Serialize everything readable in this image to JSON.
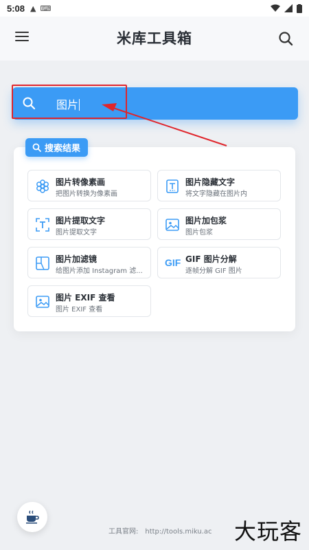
{
  "status_bar": {
    "time": "5:08"
  },
  "app_bar": {
    "title": "米库工具箱"
  },
  "search": {
    "query": "图片"
  },
  "results": {
    "label": "搜索结果",
    "items": [
      {
        "name": "图片转像素画",
        "desc": "把图片转换为像素画",
        "icon": "flower-icon"
      },
      {
        "name": "图片隐藏文字",
        "desc": "将文字隐藏在图片内",
        "icon": "hidden-text-icon"
      },
      {
        "name": "图片提取文字",
        "desc": "图片提取文字",
        "icon": "ocr-icon"
      },
      {
        "name": "图片加包浆",
        "desc": "图片包浆",
        "icon": "image-icon"
      },
      {
        "name": "图片加滤镜",
        "desc": "给图片添加 Instagram 滤...",
        "icon": "filter-icon"
      },
      {
        "name": "GIF 图片分解",
        "desc": "逐帧分解 GIF 图片",
        "icon": "gif-icon",
        "icon_text": "GIF"
      },
      {
        "name": "图片 EXIF 查看",
        "desc": "图片 EXIF 查看",
        "icon": "image-icon"
      }
    ]
  },
  "footer": {
    "label": "工具官网:",
    "url": "http://tools.miku.ac"
  },
  "watermark": "大玩客",
  "colors": {
    "accent": "#3b9bf5",
    "highlight": "#e0252b"
  }
}
